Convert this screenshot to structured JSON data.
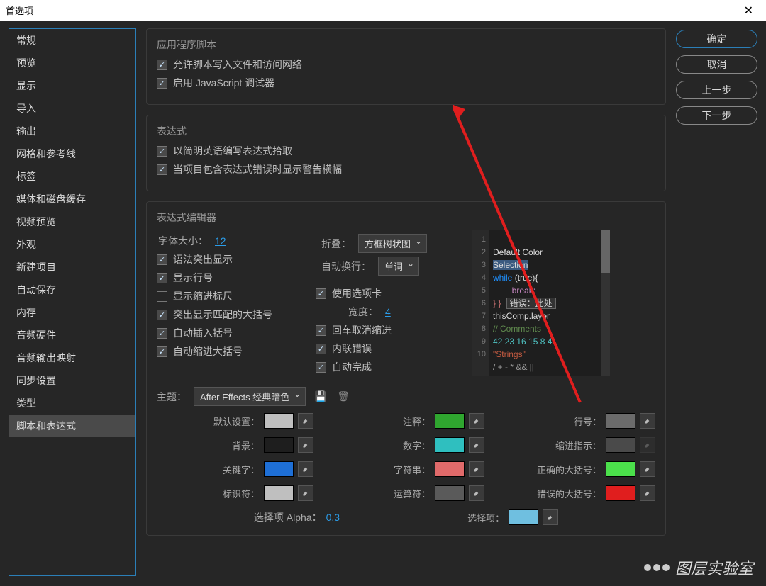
{
  "window": {
    "title": "首选项"
  },
  "buttons": {
    "ok": "确定",
    "cancel": "取消",
    "prev": "上一步",
    "next": "下一步"
  },
  "sidebar": {
    "items": [
      {
        "label": "常规"
      },
      {
        "label": "预览"
      },
      {
        "label": "显示"
      },
      {
        "label": "导入"
      },
      {
        "label": "输出"
      },
      {
        "label": "网格和参考线"
      },
      {
        "label": "标签"
      },
      {
        "label": "媒体和磁盘缓存"
      },
      {
        "label": "视频预览"
      },
      {
        "label": "外观"
      },
      {
        "label": "新建项目"
      },
      {
        "label": "自动保存"
      },
      {
        "label": "内存"
      },
      {
        "label": "音频硬件"
      },
      {
        "label": "音频输出映射"
      },
      {
        "label": "同步设置"
      },
      {
        "label": "类型"
      },
      {
        "label": "脚本和表达式",
        "selected": true
      }
    ]
  },
  "group_app": {
    "title": "应用程序脚本",
    "allow_write": "允许脚本写入文件和访问网络",
    "enable_js": "启用 JavaScript 调试器"
  },
  "group_expr": {
    "title": "表达式",
    "plain_english": "以简明英语编写表达式拾取",
    "show_warning": "当项目包含表达式错误时显示警告横幅"
  },
  "group_editor": {
    "title": "表达式编辑器",
    "font_size_label": "字体大小：",
    "font_size": "12",
    "fold_label": "折叠：",
    "fold_value": "方框树状图",
    "wrap_label": "自动换行：",
    "wrap_value": "单词",
    "syntax": "语法突出显示",
    "line_no": "显示行号",
    "indent_scale": "显示缩进标尺",
    "hl_brace": "突出显示匹配的大括号",
    "auto_brace": "自动插入括号",
    "auto_indent_brace": "自动缩进大括号",
    "use_tabs": "使用选项卡",
    "width_label": "宽度：",
    "width": "4",
    "enter_unindent": "回车取消缩进",
    "inline_err": "内联错误",
    "auto_complete": "自动完成",
    "preview": {
      "lines": [
        "1",
        "2",
        "3",
        "4",
        "5",
        "6",
        "7",
        "8",
        "9",
        "10"
      ],
      "l1": "Default Color",
      "l2": "Selection",
      "l3a": "while",
      "l3b": " (true){",
      "l4": "        break;",
      "l5": "} }",
      "l5err": "错误：此处",
      "l6": "thisComp.layer",
      "l7": "// Comments",
      "l8": "42 23 16 15 8 4",
      "l9": "\"Strings\"",
      "l10": "/ + - * && ||"
    },
    "theme_label": "主题：",
    "theme_value": "After Effects 经典暗色",
    "colors": [
      {
        "label": "默认设置：",
        "color": "#bfbfbf"
      },
      {
        "label": "注释：",
        "color": "#2fa62f"
      },
      {
        "label": "行号：",
        "color": "#6b6b6b"
      },
      {
        "label": "背景：",
        "color": "#1e1e1e"
      },
      {
        "label": "数字：",
        "color": "#2fbfbf"
      },
      {
        "label": "缩进指示：",
        "color": "#4a4a4a",
        "disabled": true
      },
      {
        "label": "关键字：",
        "color": "#1e6fd6"
      },
      {
        "label": "字符串：",
        "color": "#e06a6a"
      },
      {
        "label": "正确的大括号：",
        "color": "#4be04b"
      },
      {
        "label": "标识符：",
        "color": "#bfbfbf"
      },
      {
        "label": "运算符：",
        "color": "#5a5a5a"
      },
      {
        "label": "错误的大括号：",
        "color": "#e01e1e"
      }
    ],
    "alpha_label": "选择项 Alpha：",
    "alpha": "0.3",
    "sel_label": "选择项：",
    "sel_color": "#6fbfe0"
  },
  "watermark": "图层实验室"
}
